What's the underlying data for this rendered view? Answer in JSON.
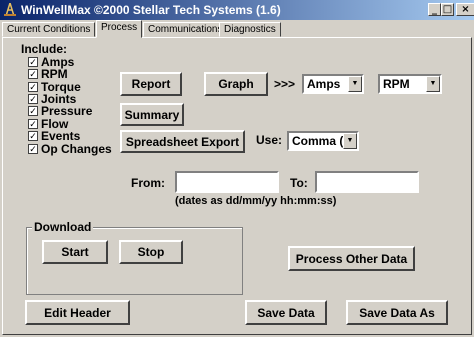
{
  "window": {
    "title": "WinWellMax  ©2000 Stellar Tech Systems (1.6)",
    "minimize": "_",
    "maximize": "□",
    "close": "×"
  },
  "tabs": [
    {
      "label": "Current Conditions",
      "active": false
    },
    {
      "label": "Process",
      "active": true
    },
    {
      "label": "Communications",
      "active": false
    },
    {
      "label": "Diagnostics",
      "active": false
    }
  ],
  "include": {
    "label": "Include:",
    "items": [
      {
        "label": "Amps",
        "checked": true
      },
      {
        "label": "RPM",
        "checked": true
      },
      {
        "label": "Torque",
        "checked": true
      },
      {
        "label": "Joints",
        "checked": true
      },
      {
        "label": "Pressure",
        "checked": true
      },
      {
        "label": "Flow",
        "checked": true
      },
      {
        "label": "Events",
        "checked": true
      },
      {
        "label": "Op Changes",
        "checked": true
      }
    ]
  },
  "buttons": {
    "report": "Report",
    "graph": "Graph",
    "summary": "Summary",
    "spreadsheet_export": "Spreadsheet Export",
    "start": "Start",
    "stop": "Stop",
    "process_other_data": "Process Other Data",
    "edit_header": "Edit Header",
    "save_data": "Save Data",
    "save_data_as": "Save Data As"
  },
  "graph_arrow": ">>>",
  "graph_selects": {
    "first": "Amps",
    "second": "RPM"
  },
  "use": {
    "label": "Use:",
    "value": "Comma (,)"
  },
  "dates": {
    "from_label": "From:",
    "from_value": "",
    "to_label": "To:",
    "to_value": "",
    "hint": "(dates as dd/mm/yy hh:mm:ss)"
  },
  "download": {
    "label": "Download"
  },
  "icons": {
    "app": "well-app-icon",
    "dropdown": "dropdown-arrow-icon",
    "check": "checkmark-icon"
  },
  "glyphs": {
    "check": "✓",
    "arrow_down": "▼"
  }
}
